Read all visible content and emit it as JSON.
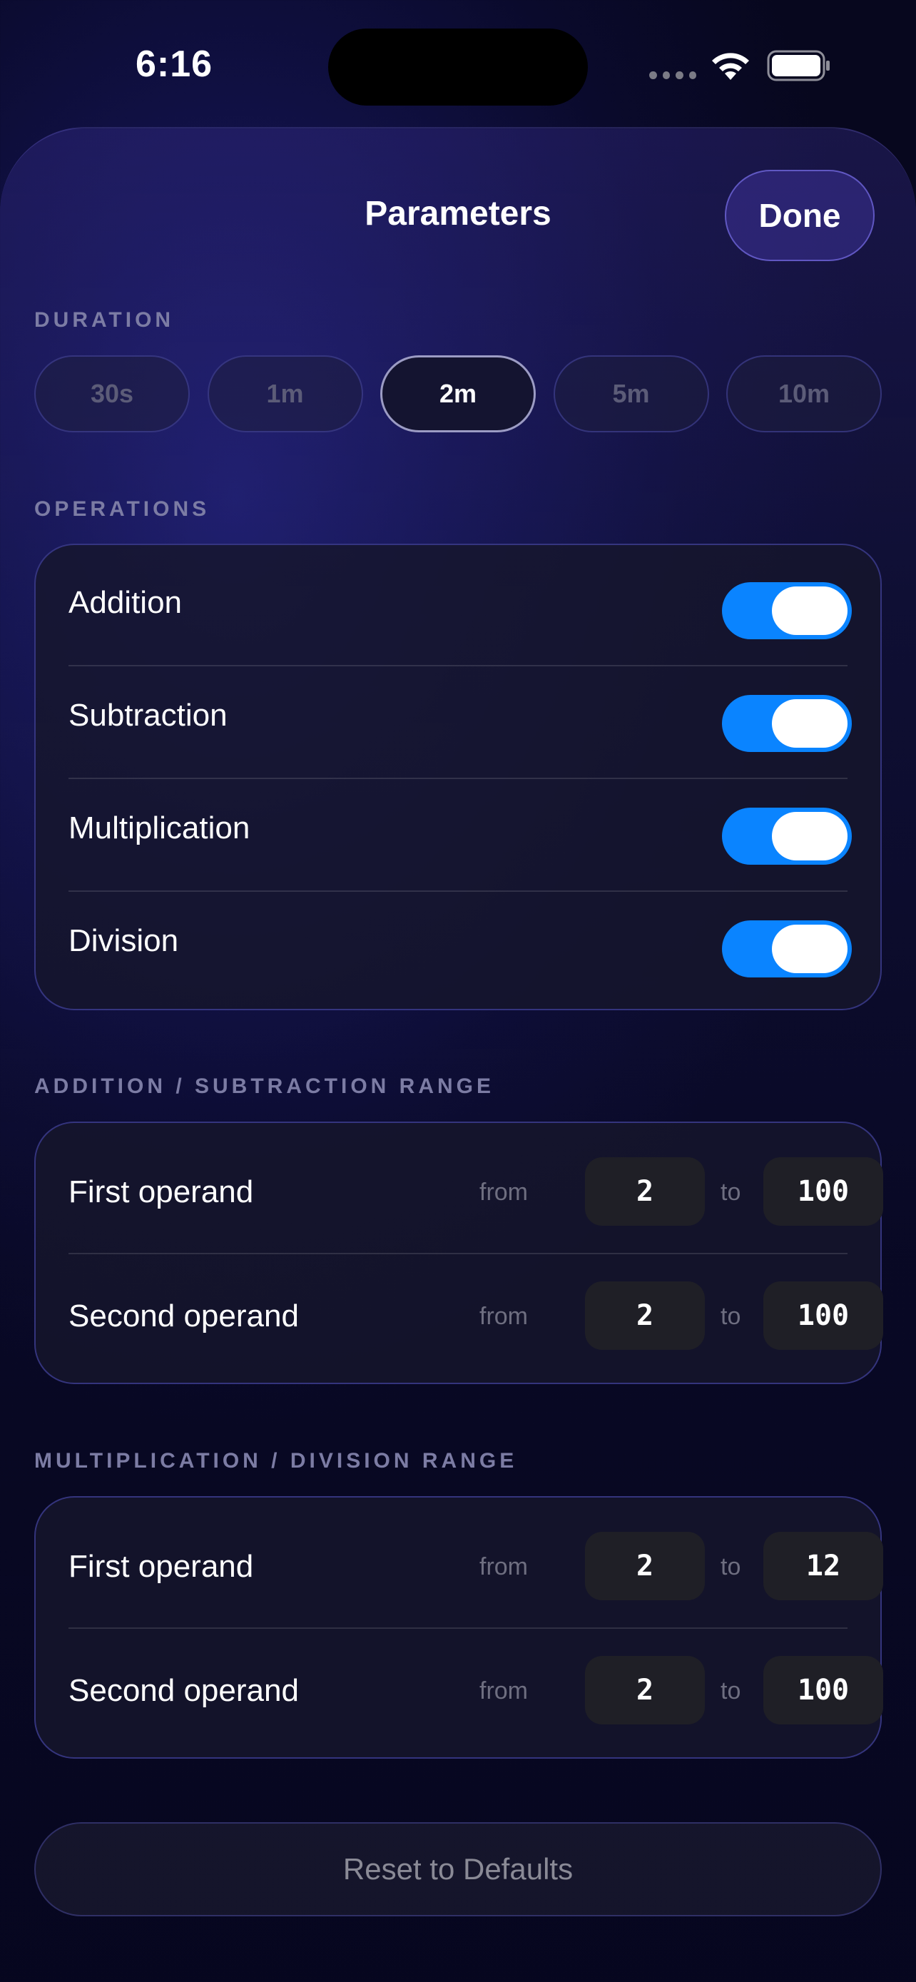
{
  "status_bar": {
    "time": "6:16",
    "icons": [
      "cellular-dots-icon",
      "wifi-icon",
      "battery-icon"
    ]
  },
  "header": {
    "title": "Parameters",
    "done_label": "Done"
  },
  "duration": {
    "label": "DURATION",
    "options": [
      "30s",
      "1m",
      "2m",
      "5m",
      "10m"
    ],
    "selected": "2m"
  },
  "operations": {
    "label": "OPERATIONS",
    "items": [
      {
        "label": "Addition",
        "enabled": true
      },
      {
        "label": "Subtraction",
        "enabled": true
      },
      {
        "label": "Multiplication",
        "enabled": true
      },
      {
        "label": "Division",
        "enabled": true
      }
    ]
  },
  "add_sub_range": {
    "label": "ADDITION / SUBTRACTION RANGE",
    "rows": [
      {
        "label": "First operand",
        "from_label": "from",
        "from": "2",
        "to_label": "to",
        "to": "100"
      },
      {
        "label": "Second operand",
        "from_label": "from",
        "from": "2",
        "to_label": "to",
        "to": "100"
      }
    ]
  },
  "mul_div_range": {
    "label": "MULTIPLICATION / DIVISION RANGE",
    "rows": [
      {
        "label": "First operand",
        "from_label": "from",
        "from": "2",
        "to_label": "to",
        "to": "12"
      },
      {
        "label": "Second operand",
        "from_label": "from",
        "from": "2",
        "to_label": "to",
        "to": "100"
      }
    ]
  },
  "reset_label": "Reset to Defaults",
  "colors": {
    "accent_toggle": "#0a84ff",
    "section_label": "#7c7ca4",
    "background": "#0a0a2c"
  }
}
